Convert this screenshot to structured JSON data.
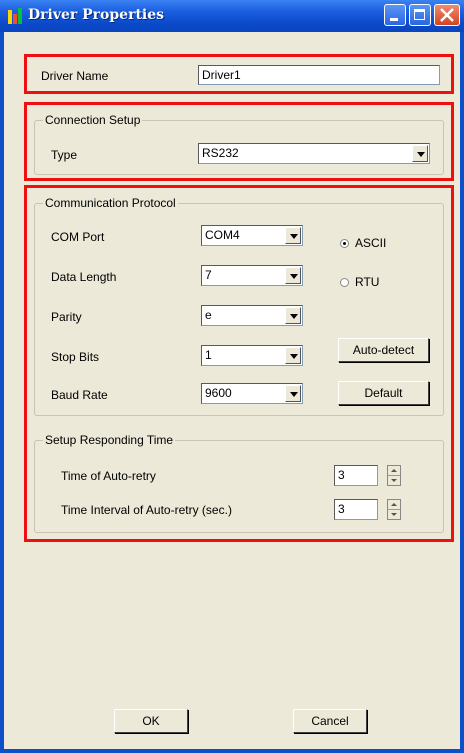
{
  "window": {
    "title": "Driver Properties"
  },
  "driver": {
    "name_label": "Driver Name",
    "name_value": "Driver1"
  },
  "connection": {
    "group_label": "Connection Setup",
    "type_label": "Type",
    "type_value": "RS232"
  },
  "protocol": {
    "group_label": "Communication Protocol",
    "com_port_label": "COM Port",
    "com_port_value": "COM4",
    "data_length_label": "Data Length",
    "data_length_value": "7",
    "parity_label": "Parity",
    "parity_value": "e",
    "stop_bits_label": "Stop Bits",
    "stop_bits_value": "1",
    "baud_rate_label": "Baud Rate",
    "baud_rate_value": "9600",
    "mode_ascii_label": "ASCII",
    "mode_rtu_label": "RTU",
    "mode_selected": "ASCII",
    "auto_detect_label": "Auto-detect",
    "default_label": "Default"
  },
  "responding": {
    "group_label": "Setup Responding Time",
    "auto_retry_label": "Time of Auto-retry",
    "auto_retry_value": "3",
    "retry_interval_label": "Time Interval of Auto-retry (sec.)",
    "retry_interval_value": "3"
  },
  "footer": {
    "ok_label": "OK",
    "cancel_label": "Cancel"
  },
  "colors": {
    "highlight": "#ee1010",
    "dialog_bg": "#ece9d8",
    "titlebar": "#0a49c9"
  }
}
